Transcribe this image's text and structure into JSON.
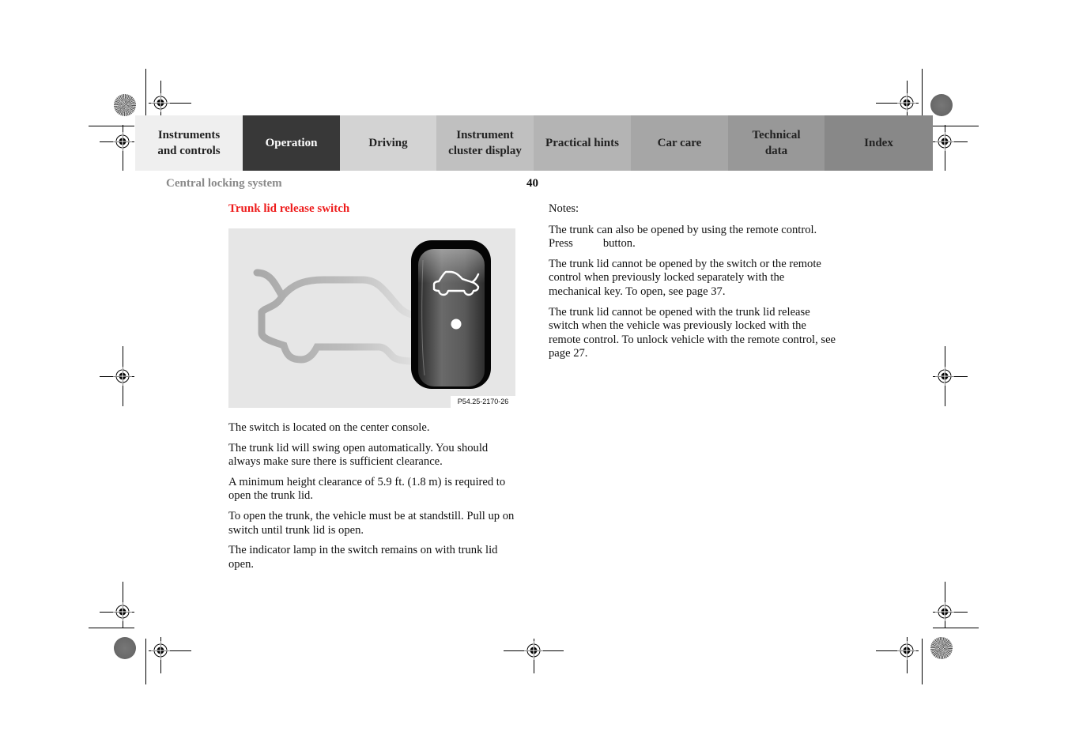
{
  "nav": {
    "tabs": [
      {
        "line1": "Instruments",
        "line2": "and controls",
        "bg": "#efefef",
        "fg": "#222222"
      },
      {
        "line1": "Operation",
        "line2": "",
        "bg": "#383838",
        "fg": "#ffffff",
        "active": true
      },
      {
        "line1": "Driving",
        "line2": "",
        "bg": "#d3d3d3",
        "fg": "#222222"
      },
      {
        "line1": "Instrument",
        "line2": "cluster display",
        "bg": "#c0c0c0",
        "fg": "#222222"
      },
      {
        "line1": "Practical hints",
        "line2": "",
        "bg": "#b4b4b4",
        "fg": "#222222"
      },
      {
        "line1": "Car care",
        "line2": "",
        "bg": "#a6a6a6",
        "fg": "#222222"
      },
      {
        "line1": "Technical",
        "line2": "data",
        "bg": "#989898",
        "fg": "#222222"
      },
      {
        "line1": "Index",
        "line2": "",
        "bg": "#888888",
        "fg": "#222222"
      }
    ]
  },
  "header": {
    "section": "Central locking system",
    "page_number": "40"
  },
  "content": {
    "title": "Trunk lid release switch",
    "figure": {
      "label": "P54.25-2170-26",
      "icons": [
        "car-outline-icon",
        "trunk-release-switch",
        "trunk-open-icon",
        "indicator-lamp"
      ]
    },
    "left_paragraphs": [
      "The switch is located on the center console.",
      "The trunk lid will swing open automatically. You should always make sure there is sufficient clearance.",
      "A minimum height clearance of 5.9 ft. (1.8 m) is required to open the trunk lid.",
      "To open the trunk, the vehicle must be at standstill. Pull up on switch until trunk lid is open.",
      "The indicator lamp in the switch remains on with trunk lid open."
    ],
    "notes": {
      "label": "Notes:",
      "p1_before": "The trunk can also be opened by using the remote control. Press",
      "p1_after": "button.",
      "p2": "The trunk lid cannot be opened by the switch or the remote control when previously locked separately with the mechanical key. To open, see page 37.",
      "p3": "The trunk lid cannot be opened with the trunk lid release switch when the vehicle was previously locked with the remote control. To unlock vehicle with the remote control, see page 27."
    }
  },
  "colors": {
    "title_red": "#ee1c1c",
    "section_gray": "#8a8a8a",
    "figure_bg": "#e6e6e6"
  }
}
